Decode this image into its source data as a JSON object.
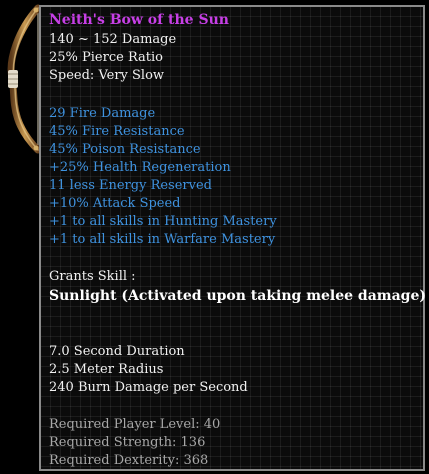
{
  "item": {
    "name": "Neith's Bow of the Sun",
    "base_stats": [
      "140 ~ 152 Damage",
      "25% Pierce Ratio",
      "Speed: Very Slow"
    ],
    "bonuses": [
      "29 Fire Damage",
      "45% Fire Resistance",
      "45% Poison Resistance",
      "+25% Health Regeneration",
      "11 less Energy Reserved",
      "+10% Attack Speed",
      "+1 to all skills in Hunting Mastery",
      "+1 to all skills in Warfare Mastery"
    ],
    "grants_label": "Grants Skill :",
    "skill_name": "Sunlight (Activated upon taking melee damage)",
    "skill_stats": [
      "7.0 Second Duration",
      "2.5 Meter Radius",
      "240 Burn Damage per Second"
    ],
    "requirements": [
      "Required Player Level: 40",
      "Required Strength: 136",
      "Required Dexterity: 368"
    ]
  },
  "colors": {
    "name": "#c73fe6",
    "base": "#f2f2f2",
    "bonus": "#3f93e0",
    "requirement": "#a8a8a8",
    "border": "#8a8a8a"
  },
  "icons": {
    "item_art": "bow-icon"
  }
}
